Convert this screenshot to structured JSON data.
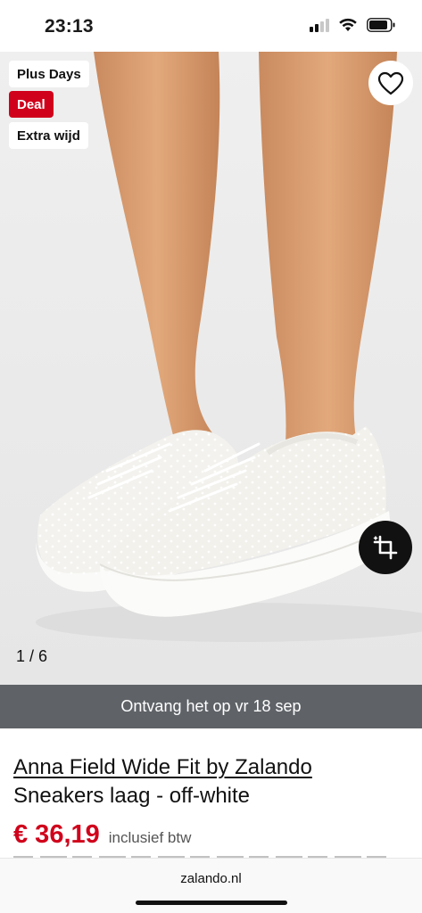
{
  "status_bar": {
    "time": "23:13",
    "icons": [
      "cellular-signal-icon",
      "wifi-icon",
      "battery-icon"
    ]
  },
  "gallery": {
    "badges": [
      {
        "label": "Plus Days",
        "style": "white"
      },
      {
        "label": "Deal",
        "style": "red"
      },
      {
        "label": "Extra wijd",
        "style": "white"
      }
    ],
    "favorite_icon": "heart-icon",
    "crop_icon": "crop-icon",
    "counter": "1 / 6"
  },
  "delivery": {
    "text": "Ontvang het op vr 18 sep"
  },
  "product": {
    "brand": "Anna Field Wide Fit by Zalando",
    "name": "Sneakers laag - off-white",
    "price": "€ 36,19",
    "vat_note": "inclusief btw"
  },
  "browser": {
    "url": "zalando.nl"
  },
  "colors": {
    "accent_red": "#d0021b",
    "delivery_bar": "#5f6368",
    "image_background": "#ececec"
  }
}
